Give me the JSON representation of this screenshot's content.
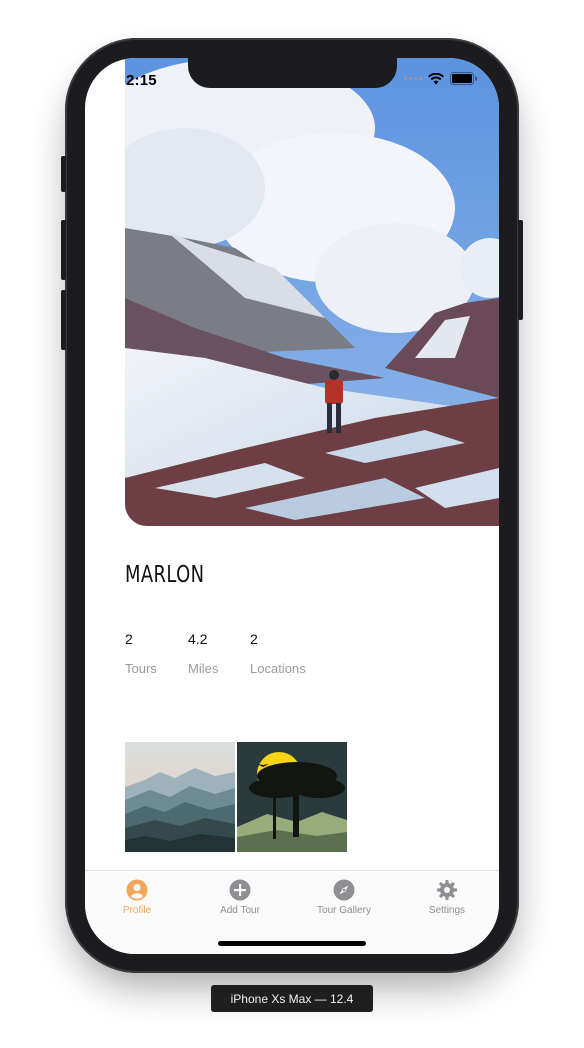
{
  "status_bar": {
    "time": "2:15"
  },
  "profile": {
    "name": "MARLON",
    "stats": [
      {
        "value": "2",
        "label": "Tours"
      },
      {
        "value": "4.2",
        "label": "Miles"
      },
      {
        "value": "2",
        "label": "Locations"
      }
    ]
  },
  "gallery": {
    "items": [
      "mountain-layers-thumbnail",
      "tree-moon-thumbnail"
    ]
  },
  "tab_bar": {
    "items": [
      {
        "label": "Profile",
        "icon": "profile-icon",
        "active": true
      },
      {
        "label": "Add Tour",
        "icon": "add-icon",
        "active": false
      },
      {
        "label": "Tour Gallery",
        "icon": "compass-icon",
        "active": false
      },
      {
        "label": "Settings",
        "icon": "gear-icon",
        "active": false
      }
    ]
  },
  "colors": {
    "accent": "#f2a65a",
    "inactive": "#8e8e93"
  },
  "simulator": {
    "device_label": "iPhone Xs Max — 12.4"
  }
}
